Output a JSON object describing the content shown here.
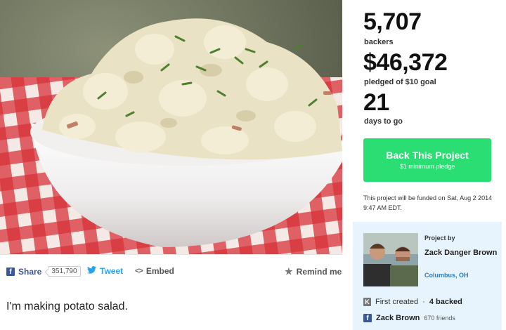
{
  "stats": {
    "backers_value": "5,707",
    "backers_label": "backers",
    "pledged_value": "$46,372",
    "pledged_label": "pledged of $10 goal",
    "days_value": "21",
    "days_label": "days to go"
  },
  "back_button": {
    "label": "Back This Project",
    "sublabel": "$1 minimum pledge",
    "color": "#2bde73"
  },
  "funding_note": "This project will be funded on Sat, Aug 2 2014 9:47 AM EDT.",
  "share": {
    "facebook_label": "Share",
    "facebook_count": "351,790",
    "twitter_label": "Tweet",
    "embed_label": "Embed",
    "remind_label": "Remind me"
  },
  "blurb": "I'm making potato salad.",
  "creator": {
    "project_by_label": "Project by",
    "name": "Zack Danger Brown",
    "location": "Columbus, OH",
    "first_created": "First created",
    "backed_count": "4 backed",
    "facebook_name": "Zack Brown",
    "friends": "670 friends"
  },
  "icons": {
    "facebook": "facebook-icon",
    "twitter": "twitter-icon",
    "embed": "embed-icon",
    "remind": "star-icon",
    "kickstarter": "kickstarter-icon"
  }
}
